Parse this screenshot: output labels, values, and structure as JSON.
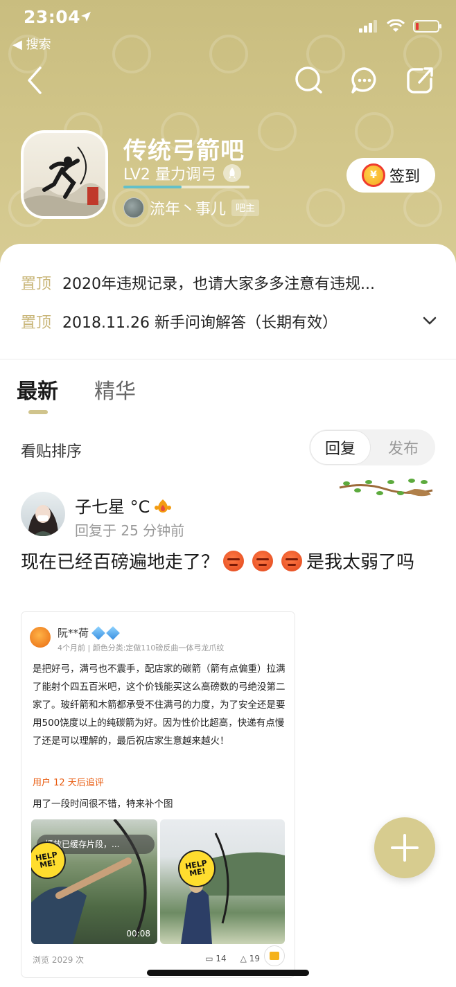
{
  "status_bar": {
    "time": "23:04",
    "back_label": "◀ 搜索"
  },
  "header": {
    "forum_name": "传统弓箭吧",
    "level": "LV2 量力调弓",
    "level_progress": 0.46,
    "owner_name": "流年丶事儿",
    "owner_badge": "吧主",
    "checkin_label": "签到",
    "checkin_coin": "¥",
    "bg_color": "#cfc387"
  },
  "pinned": [
    {
      "tag": "置顶",
      "text": "2020年违规记录，也请大家多多注意有违规..."
    },
    {
      "tag": "置顶",
      "text": "2018.11.26 新手问询解答（长期有效）"
    }
  ],
  "tabs": [
    {
      "label": "最新",
      "active": true
    },
    {
      "label": "精华",
      "active": false
    }
  ],
  "sort": {
    "label": "看贴排序",
    "options": [
      "回复",
      "发布"
    ],
    "selected": "回复"
  },
  "post": {
    "author": "子七星 °C",
    "meta": "回复于 25 分钟前",
    "title_part1": "现在已经百磅遍地走了？",
    "title_part2": "是我太弱了吗",
    "screenshot": {
      "name": "阮**荷",
      "meta": "4个月前 | 颜色分类:定做110磅反曲一体弓龙爪纹",
      "body": "是把好弓，满弓也不震手，配店家的碳箭（箭有点偏重）拉满了能射个四五百米吧，这个价钱能买这么高磅数的弓绝没第二家了。玻纤箭和木箭都承受不住满弓的力度，为了安全还是要用500饶度以上的纯碳箭为好。因为性价比超高，快递有点慢了还是可以理解的，最后祝店家生意越来越火！",
      "followup_tag": "用户 12 天后追评",
      "followup_text": "用了一段时间很不错，特来补个图",
      "cache_tip": "播放已缓存片段，...",
      "video_time": "00:08",
      "help_badge": "HELP ME!",
      "views": "浏览 2029 次",
      "comments": "14",
      "likes": "19"
    }
  },
  "colors": {
    "accent": "#c9b679",
    "fab": "#d7cc8f",
    "progress": "#62c0c9"
  },
  "icons": [
    "back-icon",
    "search-icon",
    "message-icon",
    "share-icon",
    "rocket-icon",
    "chevron-down-icon",
    "plus-icon"
  ]
}
